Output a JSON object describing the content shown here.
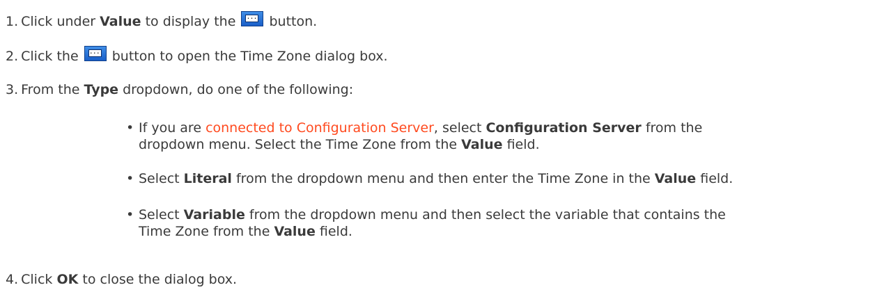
{
  "steps": [
    {
      "num": "1.",
      "text_before": "Click under ",
      "bold1": "Value",
      "text_mid": " to display the ",
      "text_after": " button."
    },
    {
      "num": "2.",
      "text_before": "Click the ",
      "text_after": " button to open the Time Zone dialog box."
    },
    {
      "num": "3.",
      "text_before": "From the ",
      "bold1": "Type",
      "text_after": " dropdown, do one of the following:"
    },
    {
      "num": "4.",
      "text_before": "Click ",
      "bold1": "OK",
      "text_after": " to close the dialog box."
    }
  ],
  "bullets": [
    {
      "t1": "If you are ",
      "link": "connected to Configuration Server",
      "t2": ", select ",
      "b1": "Configuration Server",
      "t3": " from the",
      "line2_t1": "dropdown menu. Select the Time Zone from the ",
      "line2_b1": "Value",
      "line2_t2": " field."
    },
    {
      "t1": "Select ",
      "b1": "Literal",
      "t2": " from the dropdown menu and then enter the Time Zone in the ",
      "b2": "Value",
      "t3": " field."
    },
    {
      "t1": "Select ",
      "b1": "Variable",
      "t2": " from the dropdown menu and then select the variable that contains the",
      "line2_t1": "Time Zone from the ",
      "line2_b1": "Value",
      "line2_t2": " field."
    }
  ],
  "bullet_glyph": "•",
  "icons": {
    "browse_button": "ellipsis-button-icon",
    "browse_dots": "....",
    "link_color": "#ff4a1f"
  }
}
